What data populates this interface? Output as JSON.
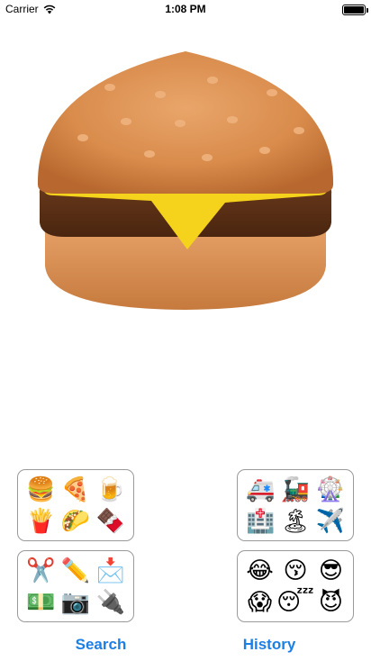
{
  "status_bar": {
    "carrier": "Carrier",
    "time": "1:08 PM",
    "battery_level": 1.0
  },
  "hero": {
    "emoji_name": "hamburger",
    "icon": "hamburger-icon"
  },
  "tiles": {
    "food": [
      "🍔",
      "🍕",
      "🍺",
      "🍟",
      "🌮",
      "🍫"
    ],
    "travel": [
      "🚑",
      "🚂",
      "🎡",
      "🏥",
      "🏝",
      "✈️"
    ],
    "objects": [
      "✂️",
      "✏️",
      "📩",
      "💵",
      "📷",
      "🔌"
    ],
    "faces": [
      "😂",
      "😚",
      "😎",
      "😱",
      "😴",
      "😈"
    ]
  },
  "tabs": {
    "search": "Search",
    "history": "History"
  },
  "colors": {
    "accent": "#1c7fe6",
    "tile_border": "#9a9a9a"
  }
}
